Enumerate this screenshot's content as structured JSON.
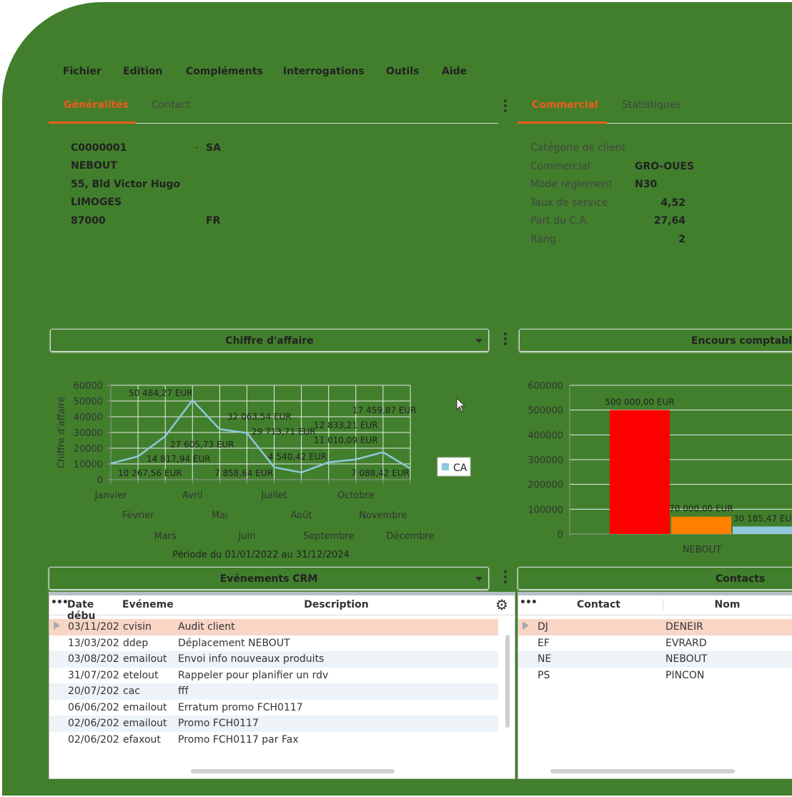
{
  "menu": [
    "Fichier",
    "Edition",
    "Compléments",
    "Interrogations",
    "Outils",
    "Aide"
  ],
  "left_tabs": [
    "Généralités",
    "Contact"
  ],
  "right_tabs": [
    "Commercial",
    "Statistiques"
  ],
  "client": {
    "code": "C0000001",
    "dash": "-",
    "forme": "SA",
    "nom": "NEBOUT",
    "adresse": "55, Bld Victor Hugo",
    "ville": "LIMOGES",
    "cp": "87000",
    "pays": "FR"
  },
  "commercial": [
    {
      "label": "Catégorie de client",
      "value": ""
    },
    {
      "label": "Commercial",
      "value": "GRO-OUES"
    },
    {
      "label": "Mode règlement",
      "value": "N30"
    },
    {
      "label": "Taux de service",
      "value": "4,52"
    },
    {
      "label": "Part du C.A.",
      "value": "27,64"
    },
    {
      "label": "Rang",
      "value": "2"
    }
  ],
  "chart_select": "Chiffre d'affaire",
  "encours_select": "Encours comptable",
  "chart_data": [
    {
      "type": "line",
      "ylabel": "Chiffre d'affaire",
      "xlabel": "Période du 01/01/2022 au 31/12/2024",
      "ylim": [
        0,
        60000
      ],
      "yticks": [
        0,
        10000,
        20000,
        30000,
        40000,
        50000,
        60000
      ],
      "grid": true,
      "legend": "right",
      "categories": [
        "Janvier",
        "Février",
        "Mars",
        "Avril",
        "Mai",
        "Juin",
        "Juillet",
        "Août",
        "Septembre",
        "Octobre",
        "Novembre",
        "Décembre"
      ],
      "series": [
        {
          "name": "CA",
          "color": "#8ec8dc",
          "values": [
            10267.56,
            14817.94,
            27605.73,
            50484.27,
            32063.54,
            29713.71,
            7858.64,
            4540.42,
            11010.09,
            12833.21,
            17459.87,
            7088.42
          ],
          "labels": [
            "10 267,56 EUR",
            "14 817,94 EUR",
            "27 605,73 EUR",
            "50 484,27 EUR",
            "32 063,54 EUR",
            "29 713,71 EUR",
            "7 858,64 EUR",
            "4 540,42 EUR",
            "11 010,09 EUR",
            "12 833,21 EUR",
            "17 459,87 EUR",
            "7 088,42 EUR"
          ]
        }
      ]
    },
    {
      "type": "bar",
      "ylim": [
        0,
        600000
      ],
      "yticks": [
        0,
        100000,
        200000,
        300000,
        400000,
        500000,
        600000
      ],
      "grid": true,
      "categories": [
        "NEBOUT"
      ],
      "bars": [
        {
          "value": 500000,
          "label": "500 000,00 EUR",
          "color": "#ff0000"
        },
        {
          "value": 70000,
          "label": "70 000,00 EUR",
          "color": "#ff8000"
        },
        {
          "value": 30185.47,
          "label": "30 185,47 EUR",
          "color": "#8ec8dc"
        }
      ]
    }
  ],
  "crm": {
    "title": "Evénements CRM",
    "columns": [
      "Date débu",
      "Evénemer",
      "Description"
    ],
    "rows": [
      [
        "03/11/202:",
        "cvisin",
        "Audit client"
      ],
      [
        "13/03/202:",
        "ddep",
        "Déplacement NEBOUT"
      ],
      [
        "03/08/202:",
        "emailout",
        "Envoi info nouveaux produits"
      ],
      [
        "31/07/202:",
        "etelout",
        "Rappeler pour planifier un rdv"
      ],
      [
        "20/07/202:",
        "cac",
        "fff"
      ],
      [
        "06/06/202:",
        "emailout",
        "Erratum promo FCH0117"
      ],
      [
        "02/06/202:",
        "emailout",
        "Promo FCH0117"
      ],
      [
        "02/06/202:",
        "efaxout",
        "Promo FCH0117 par Fax"
      ]
    ]
  },
  "contacts": {
    "title": "Contacts",
    "columns": [
      "Contact",
      "Nom"
    ],
    "rows": [
      [
        "DJ",
        "DENEIR"
      ],
      [
        "EF",
        "EVRARD"
      ],
      [
        "NE",
        "NEBOUT"
      ],
      [
        "PS",
        "PINCON"
      ]
    ]
  },
  "colors": {
    "frame": "#417f2c",
    "accent": "#ef5b1e",
    "selected_row": "#f8d5c5"
  }
}
